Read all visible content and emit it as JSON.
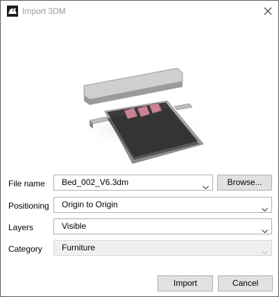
{
  "window": {
    "title": "Import 3DM"
  },
  "form": {
    "file_name": {
      "label": "File name",
      "value": "Bed_002_V6.3dm"
    },
    "browse_label": "Browse...",
    "positioning": {
      "label": "Positioning",
      "value": "Origin to Origin"
    },
    "layers": {
      "label": "Layers",
      "value": "Visible"
    },
    "category": {
      "label": "Category",
      "value": "Furniture"
    }
  },
  "buttons": {
    "import_label": "Import",
    "cancel_label": "Cancel"
  },
  "icons": {
    "app": "rhino-app-icon",
    "close": "close-icon",
    "dropdown": "chevron-down-icon"
  },
  "colors": {
    "title_text": "#9a9a9a",
    "button_face": "#e1e1e1",
    "border": "#adadad"
  }
}
